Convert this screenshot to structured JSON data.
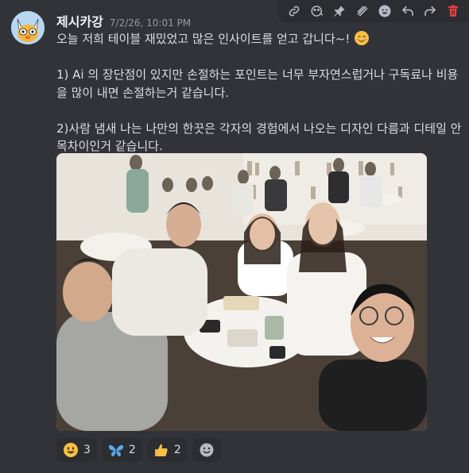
{
  "message": {
    "username": "제시카강",
    "timestamp": "7/2/26, 10:01 PM",
    "line1": "오늘 저희 테이블 재밌었고 많은 인사이트를 얻고 갑니다~!",
    "para2": "1) Ai 의 장단점이 있지만 손절하는 포인트는 너무 부자연스럽거나 구독료나 비용을 많이 내면 손절하는거 같습니다.",
    "para3": "2)사람 냄새 나는 나만의 한끗은  각자의 경험에서 나오는 디자인 다름과 디테일 안목차이인거 같습니다."
  },
  "toolbar": [
    "link-icon",
    "reply-thread-icon",
    "pin-icon",
    "message-slash-icon",
    "emoji-icon",
    "reply-icon",
    "forward-icon",
    "delete-icon"
  ],
  "reactions": [
    {
      "icon": "smiley-emoji",
      "count": "3"
    },
    {
      "icon": "butterfly-emoji",
      "count": "2"
    },
    {
      "icon": "thumbs-up-emoji",
      "count": "2"
    }
  ],
  "colors": {
    "background": "#313338",
    "delete": "#f23f43",
    "butterfly": "#5aa9e6"
  }
}
